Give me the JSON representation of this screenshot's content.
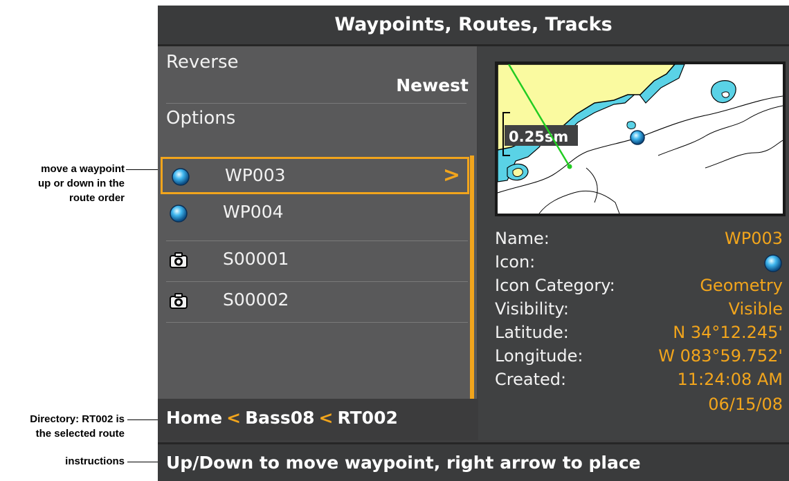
{
  "callouts": {
    "move": [
      "move a waypoint",
      "up or down in the",
      "route order"
    ],
    "directory": [
      "Directory: RT002 is",
      "the selected route"
    ],
    "instructions": "instructions"
  },
  "title": "Waypoints, Routes, Tracks",
  "menu": {
    "reverse_label": "Reverse",
    "reverse_value": "Newest",
    "options_label": "Options"
  },
  "list": [
    {
      "icon": "waypoint-ball-icon",
      "label": "WP003",
      "selected": true,
      "arrow": ">"
    },
    {
      "icon": "waypoint-ball-icon",
      "label": "WP004",
      "selected": false
    },
    {
      "icon": "camera-icon",
      "label": "S00001",
      "selected": false
    },
    {
      "icon": "camera-icon",
      "label": "S00002",
      "selected": false
    }
  ],
  "directory": {
    "parts": [
      "Home",
      "Bass08",
      "RT002"
    ],
    "separator": "<"
  },
  "map": {
    "scale_label": "0.25sm"
  },
  "details": {
    "name_label": "Name:",
    "name_value": "WP003",
    "icon_label": "Icon:",
    "icon_value": "waypoint-ball-icon",
    "category_label": "Icon Category:",
    "category_value": "Geometry",
    "visibility_label": "Visibility:",
    "visibility_value": "Visible",
    "latitude_label": "Latitude:",
    "latitude_value": "N 34°12.245'",
    "longitude_label": "Longitude:",
    "longitude_value": "W 083°59.752'",
    "created_label": "Created:",
    "created_time": "11:24:08 AM",
    "created_date": "06/15/08"
  },
  "instructions": "Up/Down to move waypoint, right arrow to place",
  "colors": {
    "accent": "#f2a51c",
    "panel": "#59595a",
    "bar": "#3a3b3c",
    "land": "#fafaa0",
    "shallow": "#5ad2e6",
    "track": "#22cc22"
  }
}
